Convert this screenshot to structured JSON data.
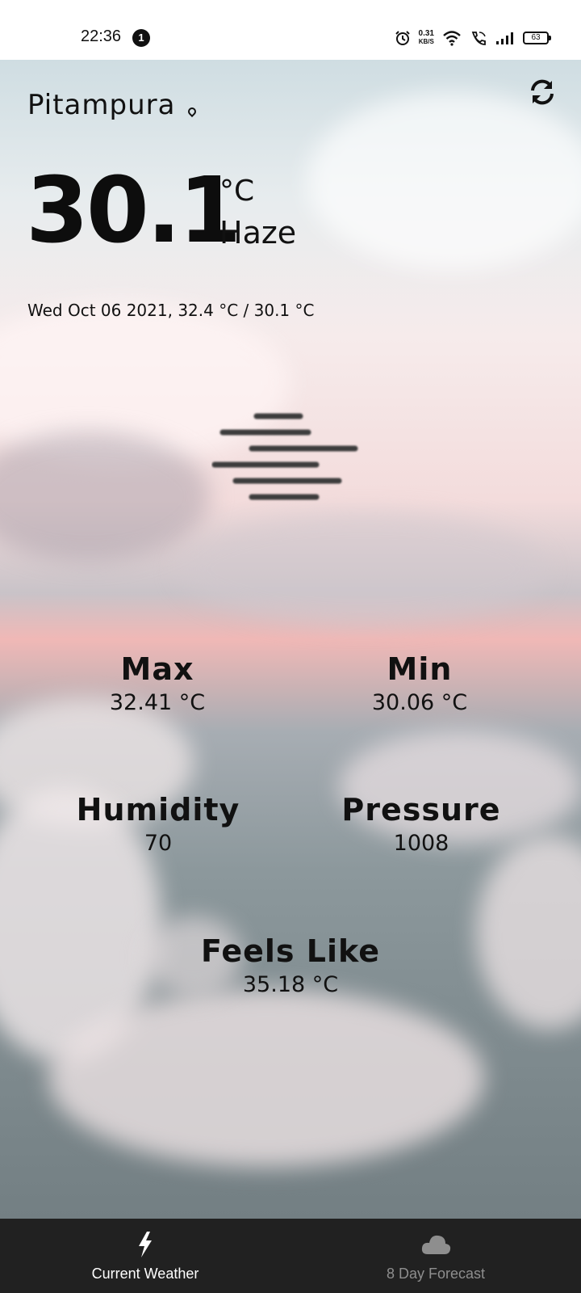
{
  "status_bar": {
    "time": "22:36",
    "notification_count": "1",
    "net_speed_value": "0.31",
    "net_speed_unit": "KB/S",
    "battery": "63",
    "icons": [
      "alarm-icon",
      "wifi-icon",
      "wifi-call-icon",
      "signal-icon",
      "battery-icon"
    ]
  },
  "weather": {
    "location": "Pitampura",
    "temperature": "30.1",
    "unit": "°C",
    "condition": "Haze",
    "date_line": "Wed Oct 06 2021, 32.4 °C / 30.1 °C"
  },
  "stats": {
    "max": {
      "label": "Max",
      "value": "32.41 °C"
    },
    "min": {
      "label": "Min",
      "value": "30.06 °C"
    },
    "humidity": {
      "label": "Humidity",
      "value": "70"
    },
    "pressure": {
      "label": "Pressure",
      "value": "1008"
    },
    "feels_like": {
      "label": "Feels Like",
      "value": "35.18 °C"
    }
  },
  "bottom_nav": {
    "items": [
      {
        "label": "Current Weather",
        "icon": "lightning-icon",
        "active": true
      },
      {
        "label": "8 Day Forecast",
        "icon": "cloud-icon",
        "active": false
      }
    ]
  },
  "colors": {
    "nav_background": "#212121",
    "nav_active": "#ffffff",
    "nav_inactive": "#8e8e8e",
    "text": "#111111"
  }
}
